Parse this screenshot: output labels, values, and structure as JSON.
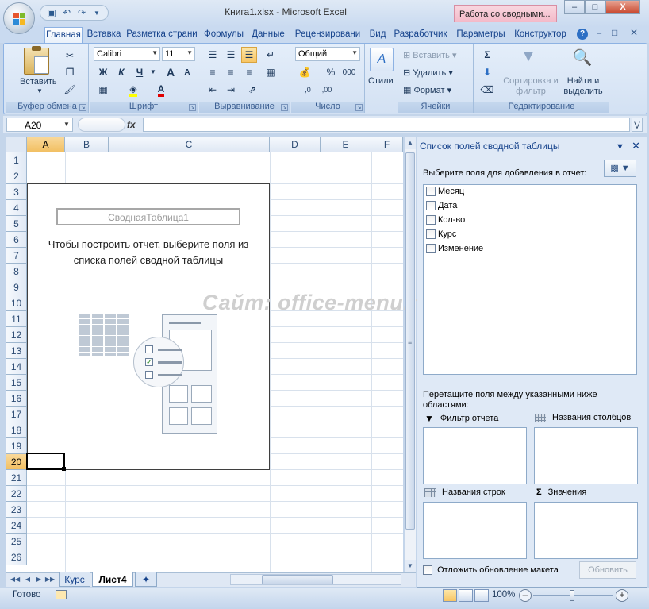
{
  "window": {
    "doc_title": "Книга1.xlsx - Microsoft Excel",
    "context_tab": "Работа со сводными...",
    "minimize": "–",
    "maximize": "□",
    "close": "X"
  },
  "ribbon_tabs": [
    "Главная",
    "Вставка",
    "Разметка страни",
    "Формулы",
    "Данные",
    "Рецензировани",
    "Вид",
    "Разработчик",
    "Параметры",
    "Конструктор"
  ],
  "ribbon": {
    "clipboard": {
      "label": "Буфер обмена",
      "paste": "Вставить"
    },
    "font": {
      "label": "Шрифт",
      "name": "Calibri",
      "size": "11",
      "bold": "Ж",
      "italic": "К",
      "underline": "Ч",
      "grow": "A",
      "shrink": "A"
    },
    "align": {
      "label": "Выравнивание"
    },
    "number": {
      "label": "Число",
      "format": "Общий",
      "percent": "%",
      "thousands": "000"
    },
    "styles": {
      "label": "Стили"
    },
    "cells": {
      "label": "Ячейки",
      "insert": "Вставить",
      "delete": "Удалить",
      "format": "Формат"
    },
    "editing": {
      "label": "Редактирование",
      "sum": "Σ",
      "sort": "Сортировка и фильтр",
      "find": "Найти и выделить"
    }
  },
  "formula_bar": {
    "name_box": "A20",
    "fx": "fx",
    "value": ""
  },
  "sheet": {
    "columns": [
      "A",
      "B",
      "C",
      "D",
      "E",
      "F"
    ],
    "rows": [
      "1",
      "2",
      "3",
      "4",
      "5",
      "6",
      "7",
      "8",
      "9",
      "10",
      "11",
      "12",
      "13",
      "14",
      "15",
      "16",
      "17",
      "18",
      "19",
      "20",
      "21",
      "22",
      "23",
      "24",
      "25",
      "26"
    ],
    "selected_cell": "A20"
  },
  "pivot": {
    "name": "СводнаяТаблица1",
    "hint": "Чтобы построить отчет, выберите поля из списка полей сводной таблицы"
  },
  "watermark": "Сайт: office-menu.ru",
  "sheet_tabs": [
    "Курс",
    "Лист4"
  ],
  "active_sheet": "Лист4",
  "field_list": {
    "title": "Список полей сводной таблицы",
    "prompt": "Выберите поля для добавления в отчет:",
    "fields": [
      {
        "name": "Месяц",
        "checked": false
      },
      {
        "name": "Дата",
        "checked": false
      },
      {
        "name": "Кол-во",
        "checked": false
      },
      {
        "name": "Курс",
        "checked": false
      },
      {
        "name": "Изменение",
        "checked": false
      }
    ],
    "drag_hint": "Перетащите поля между указанными ниже областями:",
    "areas": {
      "filter": "Фильтр отчета",
      "columns": "Названия столбцов",
      "rows": "Названия строк",
      "values": "Значения"
    },
    "defer_label": "Отложить обновление макета",
    "update_button": "Обновить"
  },
  "status": {
    "ready": "Готово",
    "zoom": "100%"
  }
}
